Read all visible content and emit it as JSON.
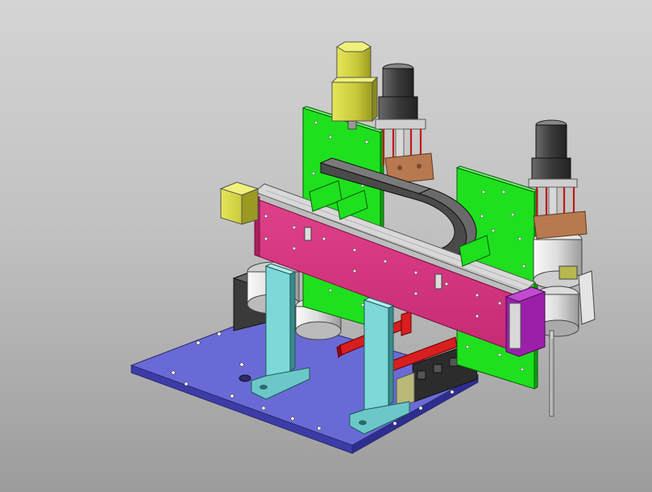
{
  "viewport": {
    "background_top": "#d4d4d4",
    "background_bottom": "#9c9c9c"
  },
  "model": {
    "description_colors": {
      "base_plate": "#6a6ad6",
      "support_column": "#7fd8d8",
      "linear_module_body": "#d8347e",
      "linear_module_end_cap": "#9b1fa8",
      "mounting_panel": "#1ee01e",
      "cable_chain": "#4a4a4a",
      "guide_rail": "#d81e1e",
      "stepper_motor_yellow": "#c8c83a",
      "stepper_motor_dark": "#3a3a3a",
      "motor_bracket": "#b87850",
      "rotary_disk": "#e4e4e4"
    },
    "parts": [
      {
        "name": "base-plate",
        "icon": "plate-icon"
      },
      {
        "name": "support-column-left",
        "icon": "column-icon"
      },
      {
        "name": "support-column-right",
        "icon": "column-icon"
      },
      {
        "name": "linear-module",
        "icon": "actuator-icon"
      },
      {
        "name": "cable-chain",
        "icon": "chain-icon"
      },
      {
        "name": "mounting-panel-left",
        "icon": "panel-icon"
      },
      {
        "name": "mounting-panel-right",
        "icon": "panel-icon"
      },
      {
        "name": "guide-rail-lower",
        "icon": "rail-icon"
      },
      {
        "name": "motor-yellow-top",
        "icon": "motor-icon"
      },
      {
        "name": "motor-yellow-side",
        "icon": "motor-icon"
      },
      {
        "name": "motor-dark-center",
        "icon": "motor-icon"
      },
      {
        "name": "motor-dark-right",
        "icon": "motor-icon"
      },
      {
        "name": "rotary-unit-right",
        "icon": "rotary-icon"
      },
      {
        "name": "rotary-unit-left",
        "icon": "rotary-icon"
      },
      {
        "name": "probe-needle",
        "icon": "needle-icon"
      }
    ]
  }
}
